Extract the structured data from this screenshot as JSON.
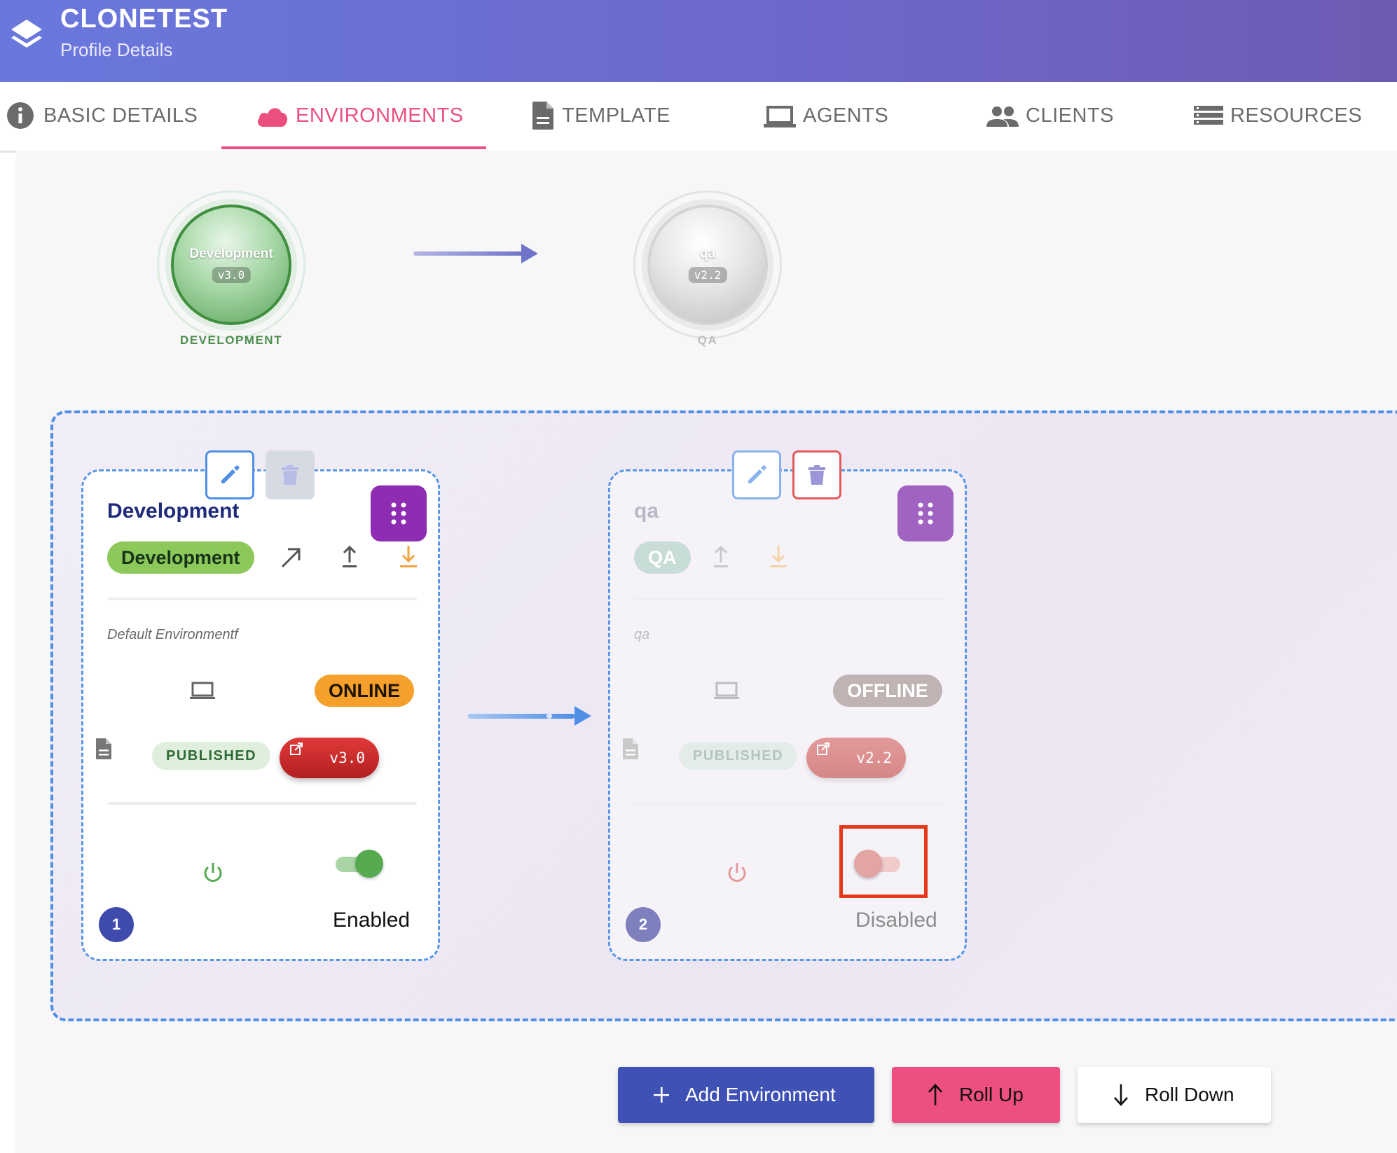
{
  "header": {
    "title": "CLONETEST",
    "subtitle": "Profile Details",
    "colors": {
      "gradient_start": "#6a78dd",
      "gradient_end": "#6e5bb3"
    }
  },
  "tabs": [
    {
      "label": "BASIC DETAILS",
      "icon": "info-icon",
      "active": false
    },
    {
      "label": "ENVIRONMENTS",
      "icon": "cloud-icon",
      "active": true
    },
    {
      "label": "TEMPLATE",
      "icon": "document-icon",
      "active": false
    },
    {
      "label": "AGENTS",
      "icon": "laptop-icon",
      "active": false
    },
    {
      "label": "CLIENTS",
      "icon": "people-icon",
      "active": false
    },
    {
      "label": "RESOURCES",
      "icon": "list-icon",
      "active": false
    }
  ],
  "pipeline": {
    "nodes": [
      {
        "name": "Development",
        "version": "v3.0",
        "caption": "DEVELOPMENT",
        "color": "#4caf50"
      },
      {
        "name": "qa",
        "version": "v2.2",
        "caption": "QA",
        "color": "#bdbdbd"
      }
    ]
  },
  "cards": [
    {
      "title": "Development",
      "env_label": "Development",
      "description": "Default Environmentf",
      "status": "ONLINE",
      "published": "PUBLISHED",
      "version": "v3.0",
      "toggle_state": "on",
      "toggle_label": "Enabled",
      "order": "1"
    },
    {
      "title": "qa",
      "env_label": "QA",
      "description": "qa",
      "status": "OFFLINE",
      "published": "PUBLISHED",
      "version": "v2.2",
      "toggle_state": "off",
      "toggle_label": "Disabled",
      "order": "2"
    }
  ],
  "actions": {
    "add_label": "Add Environment",
    "rollup_label": "Roll Up",
    "rolldown_label": "Roll Down"
  }
}
